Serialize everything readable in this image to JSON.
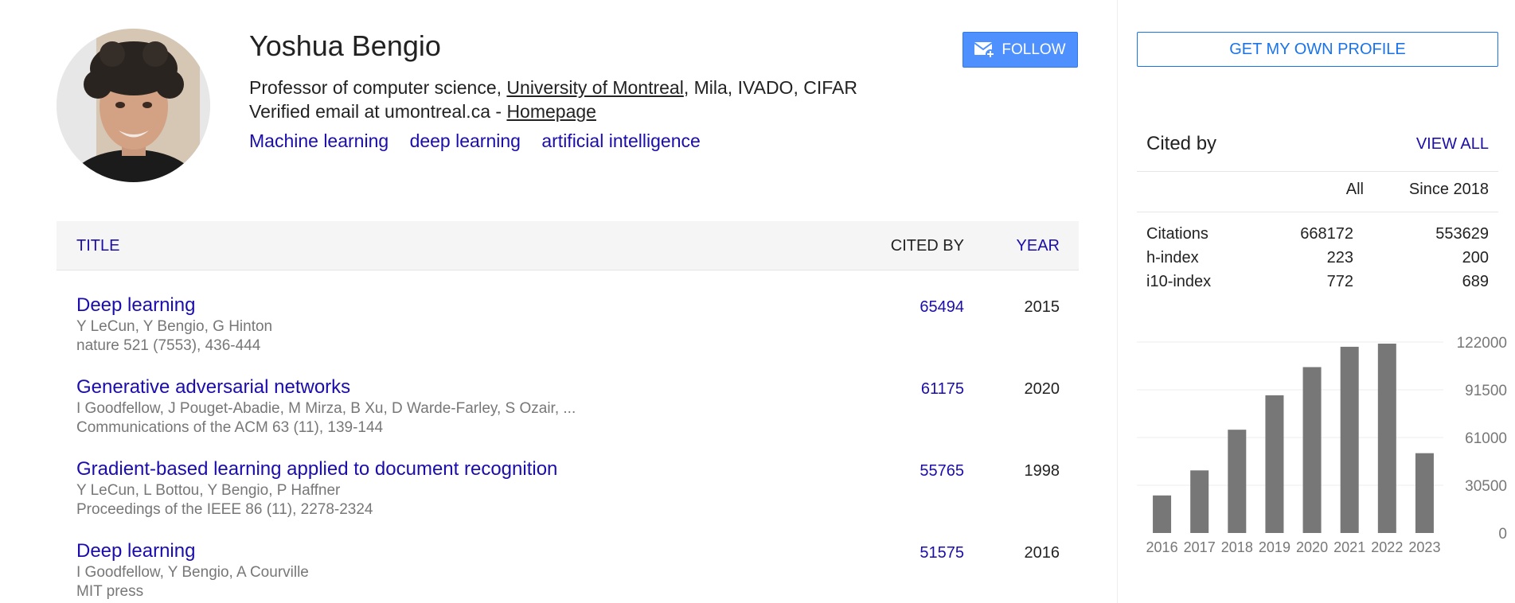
{
  "profile": {
    "name": "Yoshua Bengio",
    "affiliation_prefix": "Professor of computer science, ",
    "affiliation_link": "University of Montreal",
    "affiliation_suffix": ", Mila, IVADO, CIFAR",
    "email_text": "Verified email at umontreal.ca - ",
    "homepage_label": "Homepage",
    "interests": [
      "Machine learning",
      "deep learning",
      "artificial intelligence"
    ],
    "follow_label": "FOLLOW"
  },
  "table": {
    "headers": {
      "title": "TITLE",
      "cited_by": "CITED BY",
      "year": "YEAR"
    },
    "articles": [
      {
        "title": "Deep learning",
        "authors": "Y LeCun, Y Bengio, G Hinton",
        "venue": "nature 521 (7553), 436-444",
        "cited_by": "65494",
        "year": "2015"
      },
      {
        "title": "Generative adversarial networks",
        "authors": "I Goodfellow, J Pouget-Abadie, M Mirza, B Xu, D Warde-Farley, S Ozair, ...",
        "venue": "Communications of the ACM 63 (11), 139-144",
        "cited_by": "61175",
        "year": "2020"
      },
      {
        "title": "Gradient-based learning applied to document recognition",
        "authors": "Y LeCun, L Bottou, Y Bengio, P Haffner",
        "venue": "Proceedings of the IEEE 86 (11), 2278-2324",
        "cited_by": "55765",
        "year": "1998"
      },
      {
        "title": "Deep learning",
        "authors": "I Goodfellow, Y Bengio, A Courville",
        "venue": "MIT press",
        "cited_by": "51575",
        "year": "2016"
      }
    ]
  },
  "sidebar": {
    "own_profile_label": "GET MY OWN PROFILE",
    "cited_by_title": "Cited by",
    "view_all_label": "VIEW ALL",
    "columns": {
      "all": "All",
      "since": "Since 2018"
    },
    "stats": [
      {
        "label": "Citations",
        "all": "668172",
        "since": "553629"
      },
      {
        "label": "h-index",
        "all": "223",
        "since": "200"
      },
      {
        "label": "i10-index",
        "all": "772",
        "since": "689"
      }
    ]
  },
  "colors": {
    "link": "#1a0dab",
    "follow_button": "#4d90fe",
    "own_profile_border": "#1a73e8",
    "bar": "#777777",
    "gridline": "#eeeeee",
    "muted_text": "#777777"
  },
  "icons": {
    "follow": "mail-plus-icon"
  },
  "chart_data": {
    "type": "bar",
    "categories": [
      "2016",
      "2017",
      "2018",
      "2019",
      "2020",
      "2021",
      "2022",
      "2023"
    ],
    "values": [
      24000,
      40000,
      66000,
      88000,
      106000,
      119000,
      121000,
      51000
    ],
    "yticks": [
      0,
      30500,
      61000,
      91500,
      122000
    ],
    "ylim": [
      0,
      122000
    ],
    "grid": true,
    "title": "",
    "xlabel": "",
    "ylabel": ""
  }
}
